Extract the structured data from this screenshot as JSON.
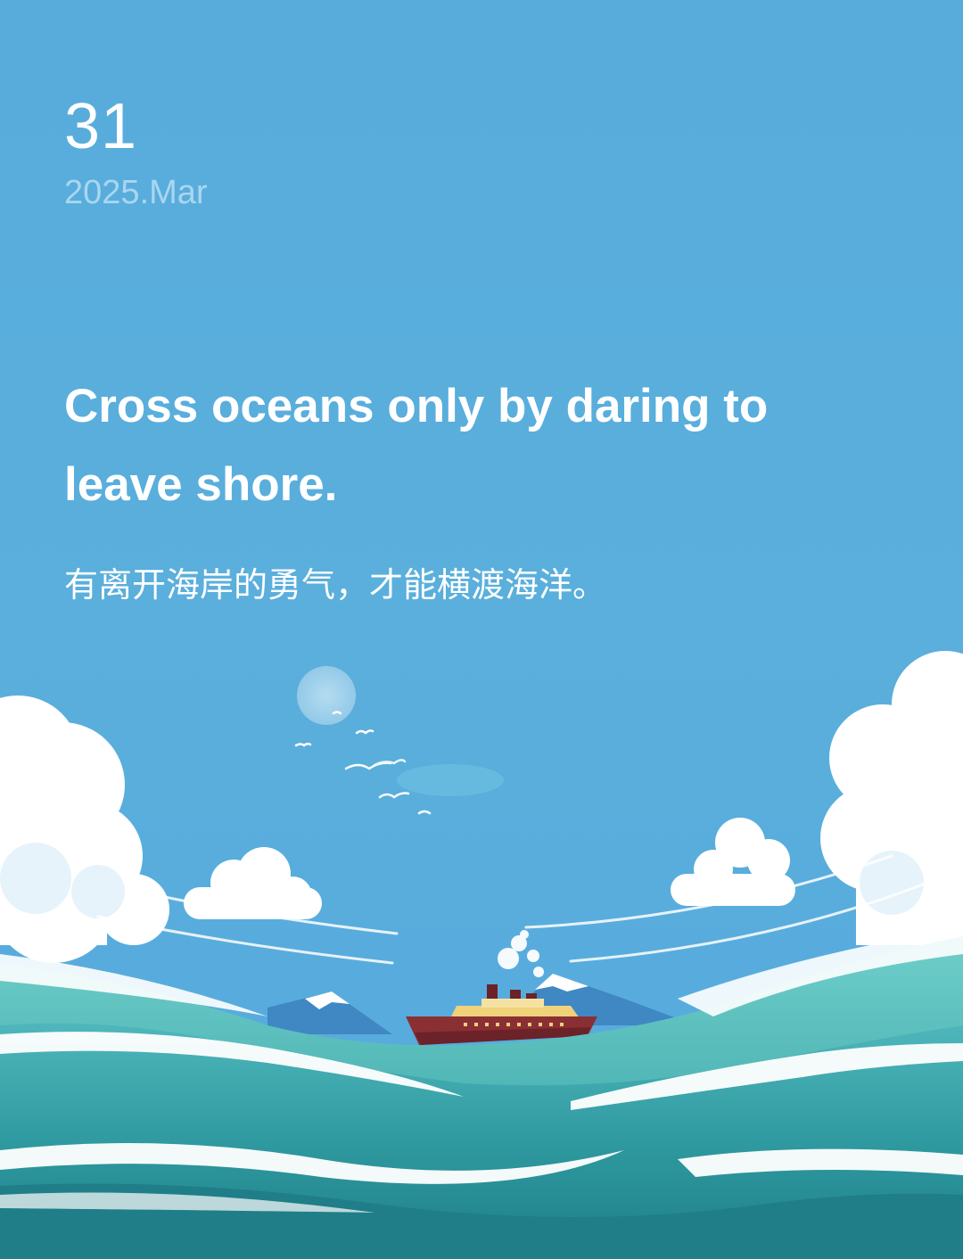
{
  "date": {
    "day": "31",
    "month": "2025.Mar"
  },
  "quote": {
    "english": "Cross oceans only by daring to leave shore.",
    "chinese": "有离开海岸的勇气，才能横渡海洋。"
  },
  "illustration": {
    "elements": [
      "sun",
      "seagulls",
      "clouds",
      "mountains",
      "ship",
      "ocean-waves"
    ],
    "colors": {
      "sky": "#57acdc",
      "sun": "#9fd0ea",
      "cloud": "#ffffff",
      "mountain": "#3f88c4",
      "ship_hull": "#8a2f33",
      "ship_deck": "#f0d27a",
      "wave_dark": "#2f9aa0",
      "wave_light": "#58c3c2"
    }
  }
}
